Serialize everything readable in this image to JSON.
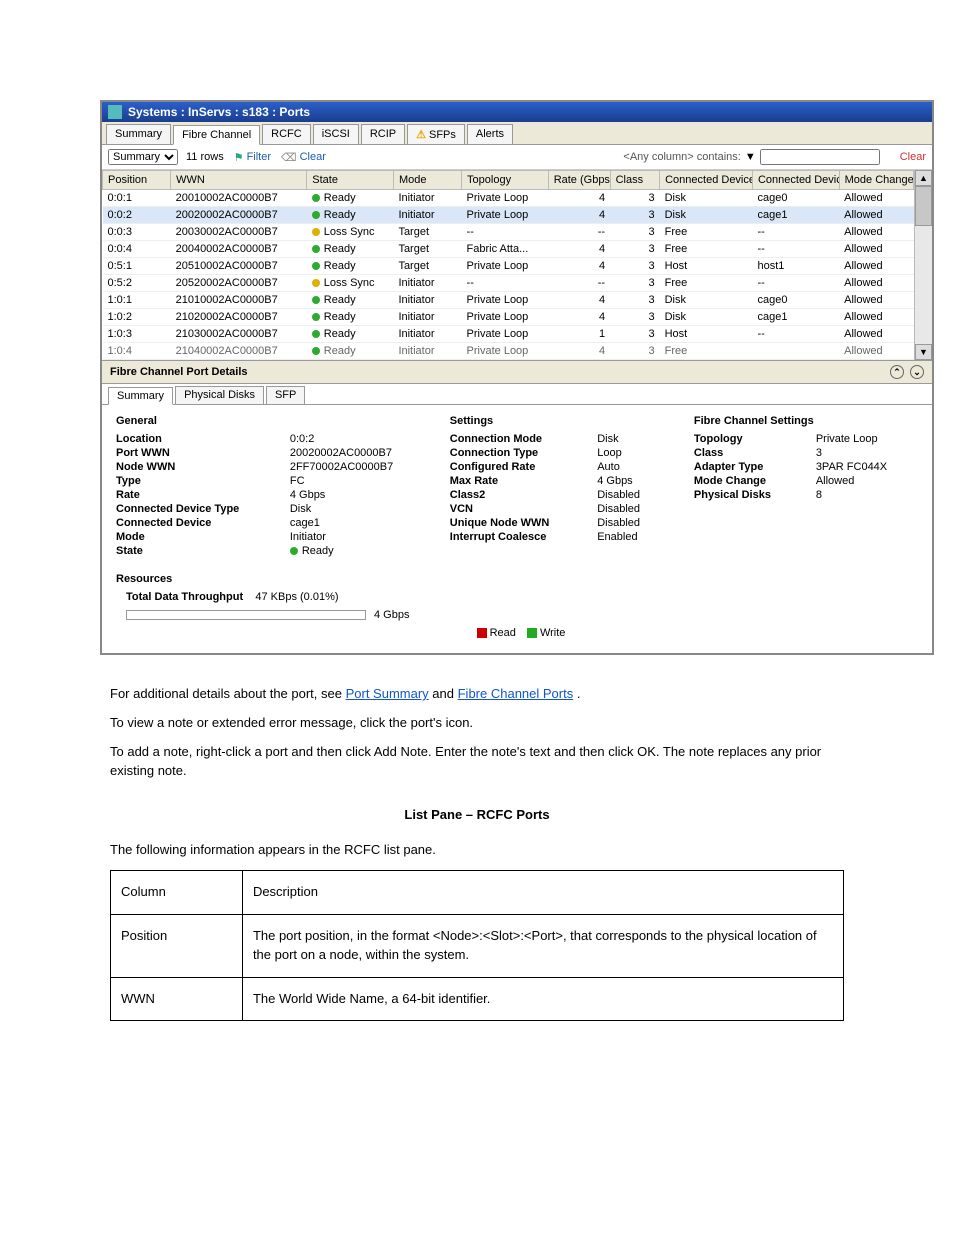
{
  "window": {
    "title": "Systems : InServs : s183 : Ports"
  },
  "tabs": [
    "Summary",
    "Fibre Channel",
    "RCFC",
    "iSCSI",
    "RCIP",
    "SFPs",
    "Alerts"
  ],
  "tabs_active": "Fibre Channel",
  "tabs_warn_icon_on": "SFPs",
  "filterbar": {
    "dropdown": "Summary",
    "rows": "11 rows",
    "filter": "Filter",
    "clear_filter": "Clear",
    "contains": "<Any column> contains:",
    "clear": "Clear"
  },
  "columns": [
    "Position",
    "WWN",
    "State",
    "Mode",
    "Topology",
    "Rate (Gbps)",
    "Class",
    "Connected Device Type",
    "Connected Device",
    "Mode Change"
  ],
  "rows": [
    {
      "pos": "0:0:1",
      "wwn": "20010002AC0000B7",
      "state": "Ready",
      "dot": "green",
      "mode": "Initiator",
      "topo": "Private Loop",
      "rate": "4",
      "cls": "3",
      "cdt": "Disk",
      "cd": "cage0",
      "mc": "Allowed"
    },
    {
      "pos": "0:0:2",
      "wwn": "20020002AC0000B7",
      "state": "Ready",
      "dot": "green",
      "mode": "Initiator",
      "topo": "Private Loop",
      "rate": "4",
      "cls": "3",
      "cdt": "Disk",
      "cd": "cage1",
      "mc": "Allowed",
      "selected": true
    },
    {
      "pos": "0:0:3",
      "wwn": "20030002AC0000B7",
      "state": "Loss Sync",
      "dot": "yellow",
      "mode": "Target",
      "topo": "--",
      "rate": "--",
      "cls": "3",
      "cdt": "Free",
      "cd": "--",
      "mc": "Allowed"
    },
    {
      "pos": "0:0:4",
      "wwn": "20040002AC0000B7",
      "state": "Ready",
      "dot": "green",
      "mode": "Target",
      "topo": "Fabric Atta...",
      "rate": "4",
      "cls": "3",
      "cdt": "Free",
      "cd": "--",
      "mc": "Allowed"
    },
    {
      "pos": "0:5:1",
      "wwn": "20510002AC0000B7",
      "state": "Ready",
      "dot": "green",
      "mode": "Target",
      "topo": "Private Loop",
      "rate": "4",
      "cls": "3",
      "cdt": "Host",
      "cd": "host1",
      "mc": "Allowed"
    },
    {
      "pos": "0:5:2",
      "wwn": "20520002AC0000B7",
      "state": "Loss Sync",
      "dot": "yellow",
      "mode": "Initiator",
      "topo": "--",
      "rate": "--",
      "cls": "3",
      "cdt": "Free",
      "cd": "--",
      "mc": "Allowed"
    },
    {
      "pos": "1:0:1",
      "wwn": "21010002AC0000B7",
      "state": "Ready",
      "dot": "green",
      "mode": "Initiator",
      "topo": "Private Loop",
      "rate": "4",
      "cls": "3",
      "cdt": "Disk",
      "cd": "cage0",
      "mc": "Allowed"
    },
    {
      "pos": "1:0:2",
      "wwn": "21020002AC0000B7",
      "state": "Ready",
      "dot": "green",
      "mode": "Initiator",
      "topo": "Private Loop",
      "rate": "4",
      "cls": "3",
      "cdt": "Disk",
      "cd": "cage1",
      "mc": "Allowed"
    },
    {
      "pos": "1:0:3",
      "wwn": "21030002AC0000B7",
      "state": "Ready",
      "dot": "green",
      "mode": "Initiator",
      "topo": "Private Loop",
      "rate": "1",
      "cls": "3",
      "cdt": "Host",
      "cd": "--",
      "mc": "Allowed"
    },
    {
      "pos": "1:0:4",
      "wwn": "21040002AC0000B7",
      "state": "Ready",
      "dot": "green",
      "mode": "Initiator",
      "topo": "Private Loop",
      "rate": "4",
      "cls": "3",
      "cdt": "Free",
      "cd": "",
      "mc": "Allowed",
      "cut": true
    }
  ],
  "details_title": "Fibre Channel Port Details",
  "subtabs": [
    "Summary",
    "Physical Disks",
    "SFP"
  ],
  "subtabs_active": "Summary",
  "panels": {
    "general": {
      "title": "General",
      "items": [
        [
          "Location",
          "0:0:2"
        ],
        [
          "Port WWN",
          "20020002AC0000B7"
        ],
        [
          "Node WWN",
          "2FF70002AC0000B7"
        ],
        [
          "Type",
          "FC"
        ],
        [
          "Rate",
          "4 Gbps"
        ],
        [
          "Connected Device Type",
          "Disk"
        ],
        [
          "Connected Device",
          "cage1"
        ],
        [
          "Mode",
          "Initiator"
        ],
        [
          "State",
          "Ready"
        ]
      ],
      "state_dot": "green"
    },
    "settings": {
      "title": "Settings",
      "items": [
        [
          "Connection Mode",
          "Disk"
        ],
        [
          "Connection Type",
          "Loop"
        ],
        [
          "Configured Rate",
          "Auto"
        ],
        [
          "Max Rate",
          "4 Gbps"
        ],
        [
          "Class2",
          "Disabled"
        ],
        [
          "VCN",
          "Disabled"
        ],
        [
          "Unique Node WWN",
          "Disabled"
        ],
        [
          "Interrupt Coalesce",
          "Enabled"
        ]
      ]
    },
    "fc": {
      "title": "Fibre Channel Settings",
      "items": [
        [
          "Topology",
          "Private Loop"
        ],
        [
          "Class",
          "3"
        ],
        [
          "Adapter Type",
          "3PAR FC044X"
        ],
        [
          "Mode Change",
          "Allowed"
        ],
        [
          "Physical Disks",
          "8"
        ]
      ]
    }
  },
  "resources": {
    "title": "Resources",
    "throughput_label": "Total Data Throughput",
    "throughput_value": "47 KBps (0.01%)",
    "bar_max": "4 Gbps",
    "legend_read": "Read",
    "legend_write": "Write"
  },
  "body": {
    "p1_prefix": "For additional details about the port, see ",
    "p1_link1": "Port Summary",
    "p1_mid": " and ",
    "p1_link2": "Fibre Channel Ports",
    "p1_suffix": ".",
    "p2": "To view a note or extended error message, click the port's icon.",
    "p3": "To add a note, right-click a port and then click Add Note. Enter the note's text and then click OK. The note replaces any prior existing note.",
    "section_title": "List Pane – RCFC Ports",
    "p4": "The following information appears in the RCFC list pane.",
    "table": [
      [
        "Column",
        "Description"
      ],
      [
        "Position",
        "The port position, in the format <Node>:<Slot>:<Port>, that corresponds to the physical location of the port on a node, within the system."
      ],
      [
        "WWN",
        "The World Wide Name, a 64-bit identifier."
      ]
    ]
  }
}
